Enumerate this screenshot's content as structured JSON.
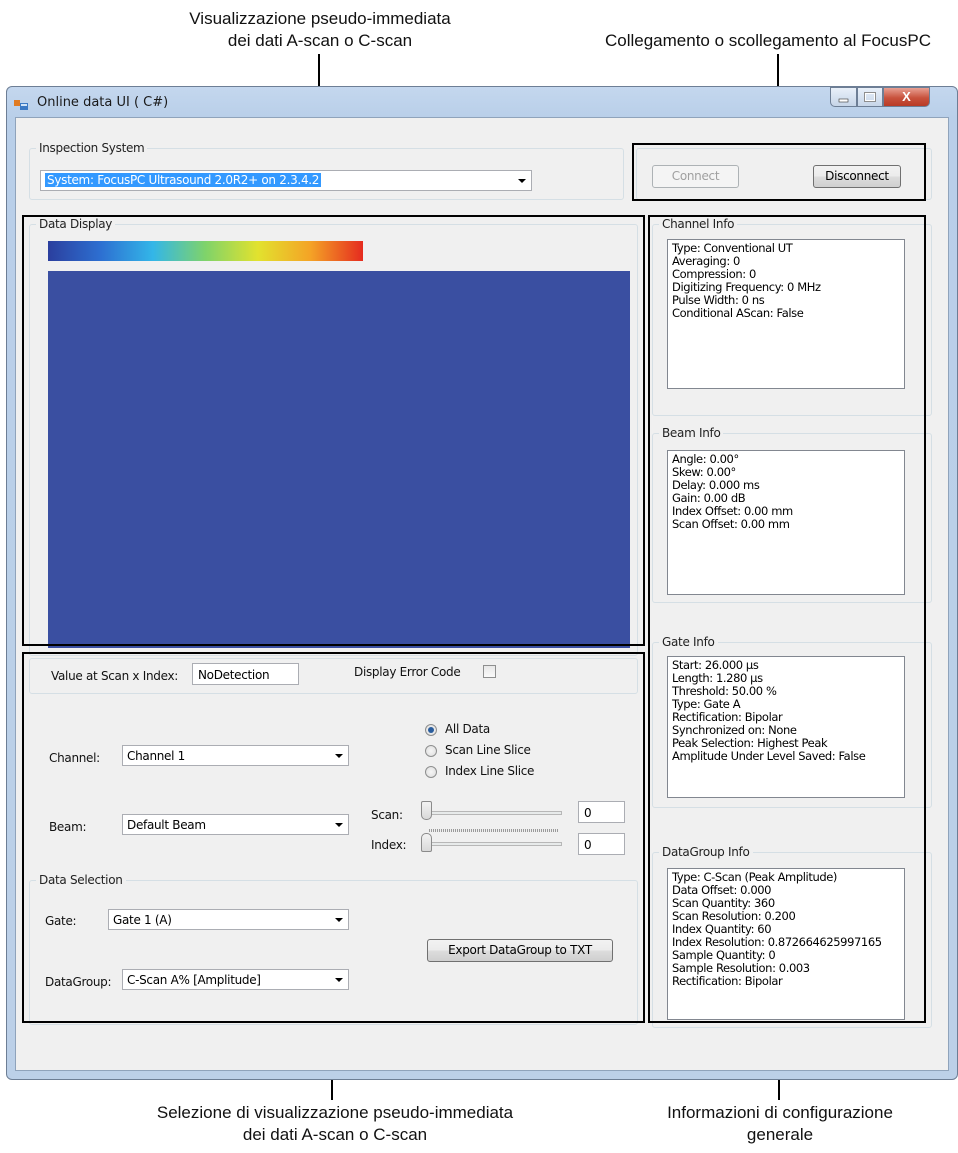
{
  "callouts": {
    "top_left_line1": "Visualizzazione pseudo-immediata",
    "top_left_line2": "dei dati A-scan o C-scan",
    "top_right": "Collegamento o scollegamento al FocusPC",
    "bottom_left_line1": "Selezione di visualizzazione pseudo-immediata",
    "bottom_left_line2": "dei dati A-scan o C-scan",
    "bottom_right_line1": "Informazioni di configurazione",
    "bottom_right_line2": "generale"
  },
  "window": {
    "title": "Online data UI ( C#)",
    "close_glyph": "X"
  },
  "inspection_system": {
    "label": "Inspection System",
    "selected": "System:  FocusPC Ultrasound 2.0R2+ on 2.3.4.2",
    "connect_label": "Connect",
    "disconnect_label": "Disconnect"
  },
  "data_display": {
    "label": "Data Display",
    "palette": [
      "#2b3f9e",
      "#2d6fd1",
      "#33b6e8",
      "#7fd36a",
      "#e2e22e",
      "#f4a326",
      "#e52b1f"
    ],
    "scan_color": "#3a4fa1"
  },
  "value_row": {
    "label": "Value at Scan x Index:",
    "value": "NoDetection",
    "error_code_label": "Display Error Code"
  },
  "selection": {
    "channel_label": "Channel:",
    "channel_value": "Channel 1",
    "beam_label": "Beam:",
    "beam_value": "Default Beam",
    "radio_all": "All Data",
    "radio_scan": "Scan Line Slice",
    "radio_index": "Index Line Slice",
    "scan_label": "Scan:",
    "scan_value": "0",
    "index_label": "Index:",
    "index_value": "0"
  },
  "data_selection": {
    "label": "Data Selection",
    "gate_label": "Gate:",
    "gate_value": "Gate 1 (A)",
    "datagroup_label": "DataGroup:",
    "datagroup_value": "C-Scan A% [Amplitude]",
    "export_label": "Export DataGroup to TXT"
  },
  "channel_info": {
    "label": "Channel Info",
    "lines": [
      "Type: Conventional UT",
      "Averaging: 0",
      "Compression: 0",
      "Digitizing Frequency: 0 MHz",
      "Pulse Width: 0 ns",
      "Conditional AScan: False"
    ]
  },
  "beam_info": {
    "label": "Beam Info",
    "lines": [
      "Angle: 0.00°",
      "Skew: 0.00°",
      "Delay: 0.000 ms",
      "Gain: 0.00 dB",
      "Index Offset: 0.00 mm",
      "Scan Offset: 0.00 mm"
    ]
  },
  "gate_info": {
    "label": "Gate Info",
    "lines": [
      "Start: 26.000 µs",
      "Length: 1.280 µs",
      "Threshold: 50.00 %",
      "Type: Gate A",
      "Rectification: Bipolar",
      "Synchronized on: None",
      "Peak Selection: Highest Peak",
      "Amplitude Under Level Saved: False"
    ]
  },
  "datagroup_info": {
    "label": "DataGroup Info",
    "lines": [
      "Type: C-Scan (Peak Amplitude)",
      "Data Offset: 0.000",
      "Scan Quantity: 360",
      "Scan Resolution: 0.200",
      "Index Quantity: 60",
      "Index Resolution: 0.872664625997165",
      "Sample Quantity: 0",
      "Sample Resolution: 0.003",
      "Rectification: Bipolar"
    ]
  }
}
